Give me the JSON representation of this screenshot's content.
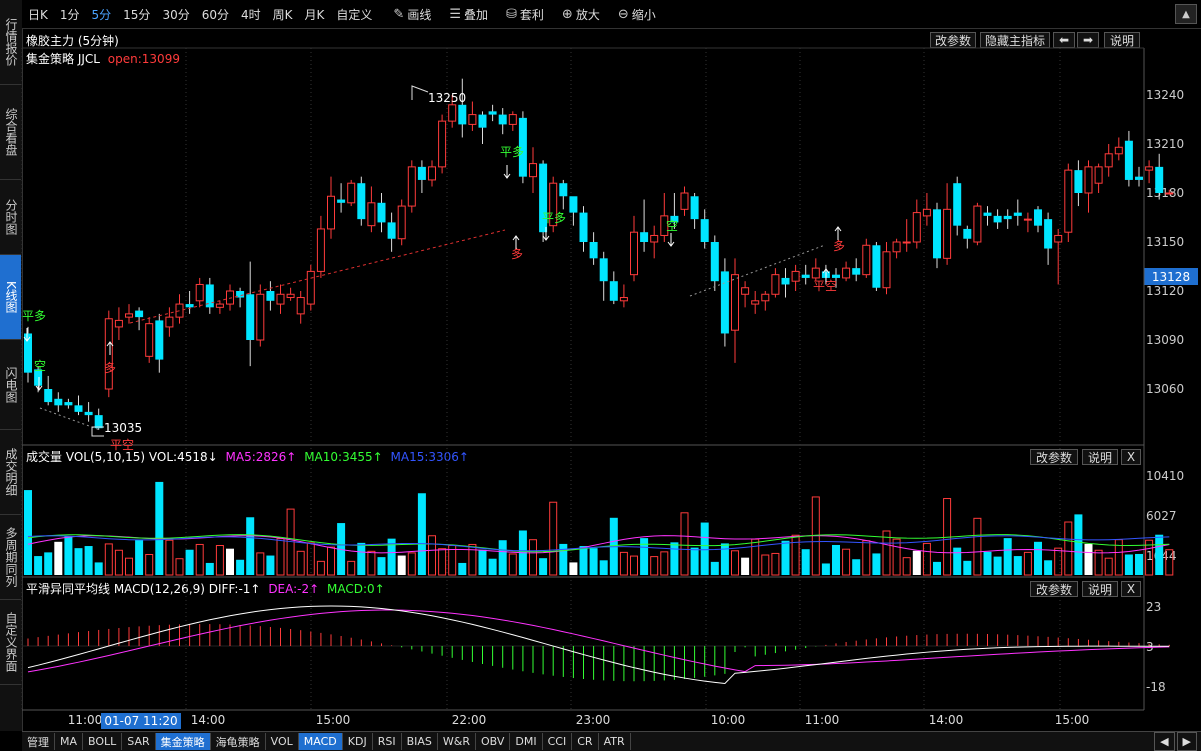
{
  "toolbar": {
    "periods": [
      "日K",
      "1分",
      "5分",
      "15分",
      "30分",
      "60分",
      "4时",
      "周K",
      "月K",
      "自定义"
    ],
    "active_period": "5分",
    "tools": [
      {
        "label": "画线",
        "icon": "pencil-icon"
      },
      {
        "label": "叠加",
        "icon": "stack-icon"
      },
      {
        "label": "套利",
        "icon": "arbitrage-icon"
      },
      {
        "label": "放大",
        "icon": "zoom-in-icon"
      },
      {
        "label": "缩小",
        "icon": "zoom-out-icon"
      }
    ]
  },
  "sidebar": {
    "tabs": [
      "行情报价",
      "综合看盘",
      "分时图",
      "K线图",
      "闪电图",
      "成交明细",
      "多周期同列",
      "自定义界面"
    ],
    "active": "K线图"
  },
  "main": {
    "title": "橡胶主力 (5分钟)",
    "strategy": "集金策略 JJCL",
    "open_label": "open:13099",
    "buttons": [
      "改参数",
      "隐藏主指标",
      "说明"
    ],
    "prices": [
      "13240",
      "13210",
      "13180",
      "13150",
      "13120",
      "13090",
      "13060"
    ],
    "current_price": "13128",
    "annotations": {
      "high": "13250",
      "low": "13035",
      "signals": [
        "平多",
        "空",
        "多",
        "平空",
        "平多",
        "多",
        "平多",
        "空",
        "多",
        "平空"
      ]
    }
  },
  "volume": {
    "title": "成交量 VOL(5,10,15) VOL:4518↓",
    "ma5": "MA5:2826↑",
    "ma10": "MA10:3455↑",
    "ma15": "MA15:3306↑",
    "axis": [
      "10410",
      "6027",
      "1644"
    ],
    "buttons": [
      "改参数",
      "说明",
      "X"
    ]
  },
  "macd": {
    "title": "平滑异同平均线 MACD(12,26,9) DIFF:-1↑",
    "dea": "DEA:-2↑",
    "macd": "MACD:0↑",
    "axis": [
      "23",
      "3",
      "-18"
    ],
    "buttons": [
      "改参数",
      "说明",
      "X"
    ]
  },
  "xaxis": {
    "labels": [
      "11:00",
      "14:00",
      "15:00",
      "22:00",
      "23:00",
      "10:00",
      "11:00",
      "14:00",
      "15:00"
    ],
    "cursor": "01-07 11:20"
  },
  "bottombar": {
    "tabs": [
      "管理",
      "MA",
      "BOLL",
      "SAR",
      "集金策略",
      "海龟策略",
      "VOL",
      "MACD",
      "KDJ",
      "RSI",
      "BIAS",
      "W&R",
      "OBV",
      "DMI",
      "CCI",
      "CR",
      "ATR"
    ],
    "active": [
      "集金策略",
      "MACD"
    ]
  },
  "colors": {
    "up": "#ff3b3b",
    "down": "#00e5ff",
    "ma5": "#ff33ff",
    "ma10": "#33ff33",
    "ma15": "#3355ff",
    "accent": "#1f6fd0"
  }
}
